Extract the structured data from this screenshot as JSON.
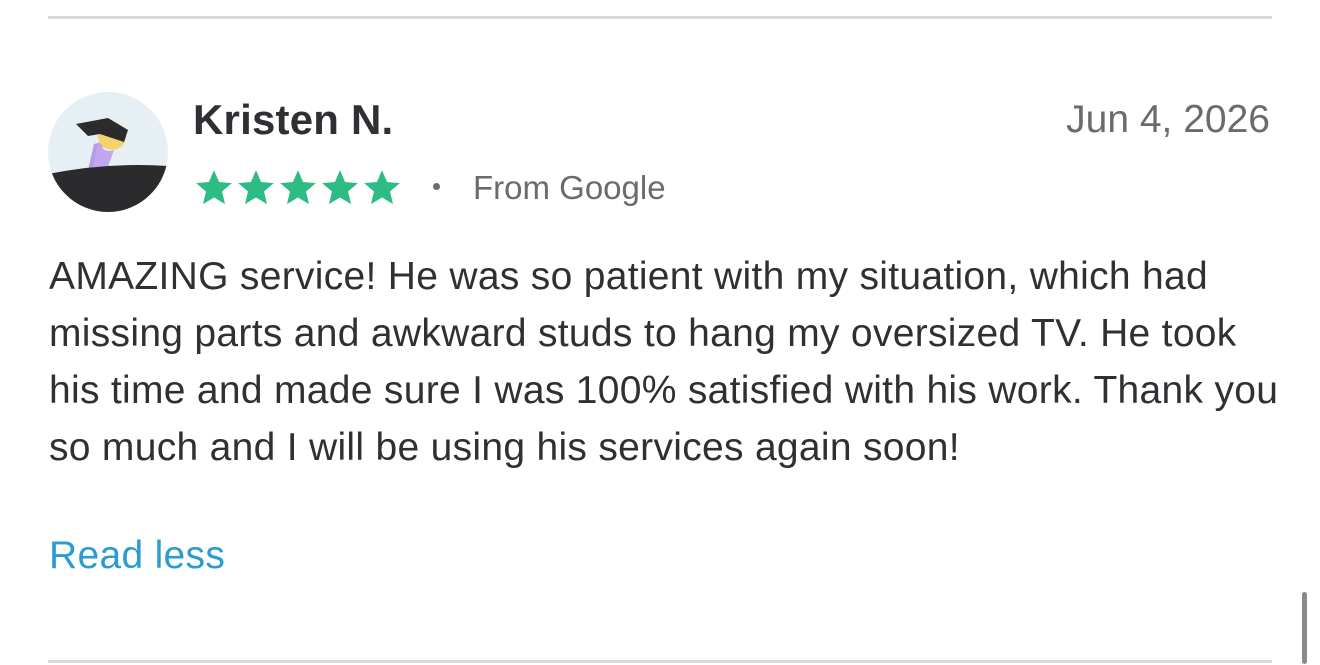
{
  "review": {
    "reviewer_name": "Kristen N.",
    "date": "Jun 4, 2026",
    "rating": 5,
    "rating_max": 5,
    "star_color": "#2ebc85",
    "source": "From Google",
    "text": "AMAZING service! He was so patient with my situation, which had missing parts and awkward studs to hang my oversized TV. He took his time and made sure I was 100% satisfied with his work. Thank you so much and I will be using his services again soon!",
    "toggle_label": "Read less",
    "link_color": "#2b9bd0",
    "avatar_icon": "avatar-illustration-icon"
  }
}
